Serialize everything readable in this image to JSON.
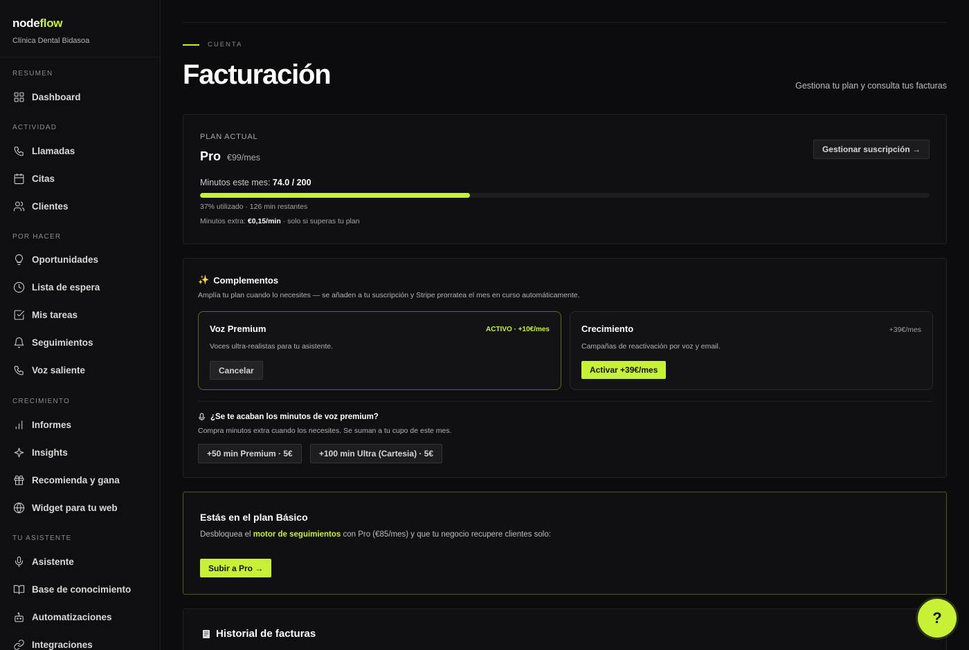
{
  "brand": {
    "name_prefix": "node",
    "name_suffix": "flow",
    "clinic": "Clínica Dental Bidasoa"
  },
  "sidebar": {
    "sections": [
      {
        "title": "RESUMEN",
        "items": [
          {
            "label": "Dashboard",
            "icon": "grid-icon"
          }
        ]
      },
      {
        "title": "ACTIVIDAD",
        "items": [
          {
            "label": "Llamadas",
            "icon": "phone-icon"
          },
          {
            "label": "Citas",
            "icon": "calendar-icon"
          },
          {
            "label": "Clientes",
            "icon": "users-icon"
          }
        ]
      },
      {
        "title": "POR HACER",
        "items": [
          {
            "label": "Oportunidades",
            "icon": "lightbulb-icon"
          },
          {
            "label": "Lista de espera",
            "icon": "clock-icon"
          },
          {
            "label": "Mis tareas",
            "icon": "checkbox-icon"
          },
          {
            "label": "Seguimientos",
            "icon": "bell-icon"
          },
          {
            "label": "Voz saliente",
            "icon": "phone-icon"
          }
        ]
      },
      {
        "title": "CRECIMIENTO",
        "items": [
          {
            "label": "Informes",
            "icon": "bar-chart-icon"
          },
          {
            "label": "Insights",
            "icon": "sparkle-icon"
          },
          {
            "label": "Recomienda y gana",
            "icon": "gift-icon"
          },
          {
            "label": "Widget para tu web",
            "icon": "globe-icon"
          }
        ]
      },
      {
        "title": "TU ASISTENTE",
        "items": [
          {
            "label": "Asistente",
            "icon": "mic-icon"
          },
          {
            "label": "Base de conocimiento",
            "icon": "book-icon"
          },
          {
            "label": "Automatizaciones",
            "icon": "robot-icon"
          },
          {
            "label": "Integraciones",
            "icon": "link-icon"
          }
        ]
      }
    ]
  },
  "header": {
    "eyebrow": "CUENTA",
    "title": "Facturación",
    "subtitle": "Gestiona tu plan y consulta tus facturas"
  },
  "plan": {
    "label": "PLAN ACTUAL",
    "name": "Pro",
    "price": "€99/mes",
    "manage_label": "Gestionar suscripción →",
    "minutes_label": "Minutos este mes:",
    "minutes_value": "74.0 / 200",
    "usage_fraction": 0.37,
    "usage_note": "37% utilizado · 126 min restantes",
    "extra_prefix": "Minutos extra:",
    "extra_price": "€0,15/min",
    "extra_suffix": "· solo si superas tu plan"
  },
  "addons": {
    "title": "Complementos",
    "desc": "Amplía tu plan cuando lo necesites — se añaden a tu suscripción y Stripe prorratea el mes en curso automáticamente.",
    "items": [
      {
        "name": "Voz Premium",
        "badge": "ACTIVO · +10€/mes",
        "desc": "Voces ultra-realistas para tu asistente.",
        "button": "Cancelar"
      },
      {
        "name": "Crecimiento",
        "price": "+39€/mes",
        "desc": "Campañas de reactivación por voz y email.",
        "button": "Activar +39€/mes"
      }
    ],
    "extra_title": "¿Se te acaban los minutos de voz premium?",
    "extra_desc": "Compra minutos extra cuando los necesites. Se suman a tu cupo de este mes.",
    "packs": [
      "+50 min Premium · 5€",
      "+100 min Ultra (Cartesia) · 5€"
    ]
  },
  "upgrade": {
    "title": "Estás en el plan Básico",
    "desc_prefix": "Desbloquea el",
    "desc_highlight": "motor de seguimientos",
    "desc_suffix": "con Pro (€85/mes) y que tu negocio recupere clientes solo:",
    "button": "Subir a Pro →"
  },
  "history": {
    "title": "Historial de facturas"
  },
  "help": {
    "label": "?"
  },
  "colors": {
    "accent": "#c6f135",
    "background": "#0c0c0e",
    "card": "#101012"
  }
}
